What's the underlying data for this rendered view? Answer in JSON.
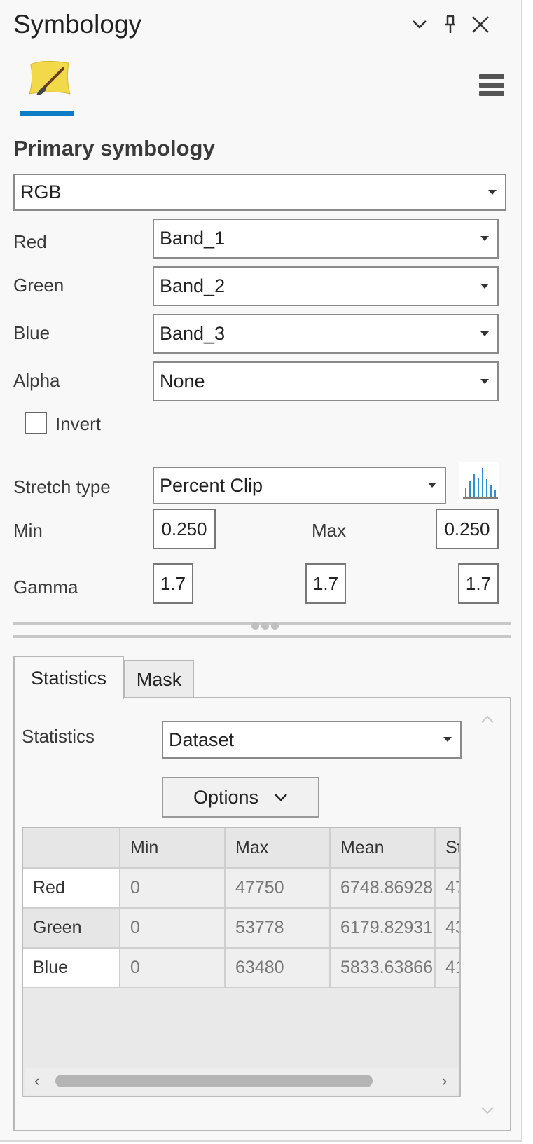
{
  "header": {
    "title": "Symbology"
  },
  "primary": {
    "section_title": "Primary symbology",
    "renderer": "RGB",
    "bands": [
      {
        "label": "Red",
        "value": "Band_1"
      },
      {
        "label": "Green",
        "value": "Band_2"
      },
      {
        "label": "Blue",
        "value": "Band_3"
      },
      {
        "label": "Alpha",
        "value": "None"
      }
    ],
    "invert_label": "Invert",
    "invert_checked": false,
    "stretch_label": "Stretch type",
    "stretch_value": "Percent Clip",
    "min_label": "Min",
    "min_value": "0.250",
    "max_label": "Max",
    "max_value": "0.250",
    "gamma_label": "Gamma",
    "gamma_values": [
      "1.7",
      "1.7",
      "1.7"
    ]
  },
  "tabs": {
    "statistics": "Statistics",
    "mask": "Mask"
  },
  "statistics": {
    "label": "Statistics",
    "source": "Dataset",
    "options_label": "Options",
    "columns": [
      "",
      "Min",
      "Max",
      "Mean",
      "St"
    ],
    "rows": [
      {
        "name": "Red",
        "min": "0",
        "max": "47750",
        "mean": "6748.86928",
        "std": "47"
      },
      {
        "name": "Green",
        "min": "0",
        "max": "53778",
        "mean": "6179.82931",
        "std": "43"
      },
      {
        "name": "Blue",
        "min": "0",
        "max": "63480",
        "mean": "5833.63866",
        "std": "41"
      }
    ]
  },
  "icons": {
    "chevron": "chevron-down-icon",
    "pin": "pin-icon",
    "close": "close-icon",
    "brush": "paintbrush-icon",
    "menu": "hamburger-menu-icon",
    "histogram": "histogram-icon"
  },
  "colors": {
    "accent": "#0e7bc5",
    "brush_yellow": "#f2d94a"
  }
}
